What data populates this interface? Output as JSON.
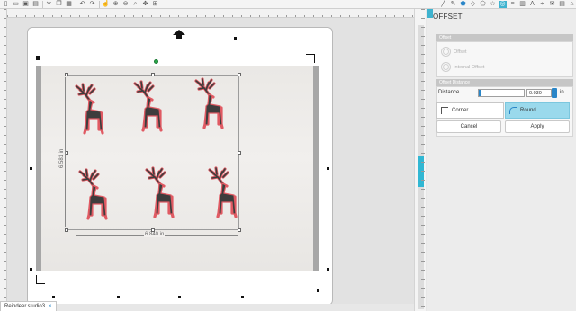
{
  "toolbar": {
    "icons": [
      "new-icon",
      "open-icon",
      "save-icon",
      "print-icon",
      "cut-icon",
      "copy-icon",
      "paste-icon",
      "undo-icon",
      "redo-icon",
      "select-icon",
      "zoom-in-icon",
      "zoom-out-icon",
      "zoom-fit-icon",
      "pan-icon",
      "fit-page-icon"
    ],
    "right_icons": [
      "line-icon",
      "pen-icon",
      "polygon-icon",
      "shape-icon",
      "pentagon-icon",
      "star-icon",
      "offset-icon",
      "align-icon",
      "replicate-icon",
      "text-icon",
      "trace-icon",
      "send-icon",
      "library-icon",
      "store-icon"
    ]
  },
  "document": {
    "tab_label": "Reindeer.studio3"
  },
  "canvas": {
    "width_label": "6.840 in",
    "height_label": "6.581 in",
    "deer_color": "#e05a63",
    "deer_fill": "#3d3d3d"
  },
  "panel": {
    "title": "OFFSET",
    "offset_section": {
      "header": "Offset",
      "options": [
        "Offset",
        "Internal Offset"
      ]
    },
    "distance_section": {
      "header": "Offset Distance",
      "distance_label": "Distance",
      "distance_value": "0.030",
      "unit": "in",
      "corner_label": "Corner",
      "round_label": "Round"
    },
    "cancel_label": "Cancel",
    "apply_label": "Apply"
  },
  "colors": {
    "accent": "#3fb3cf",
    "round_selected": "#9ad9ec"
  }
}
